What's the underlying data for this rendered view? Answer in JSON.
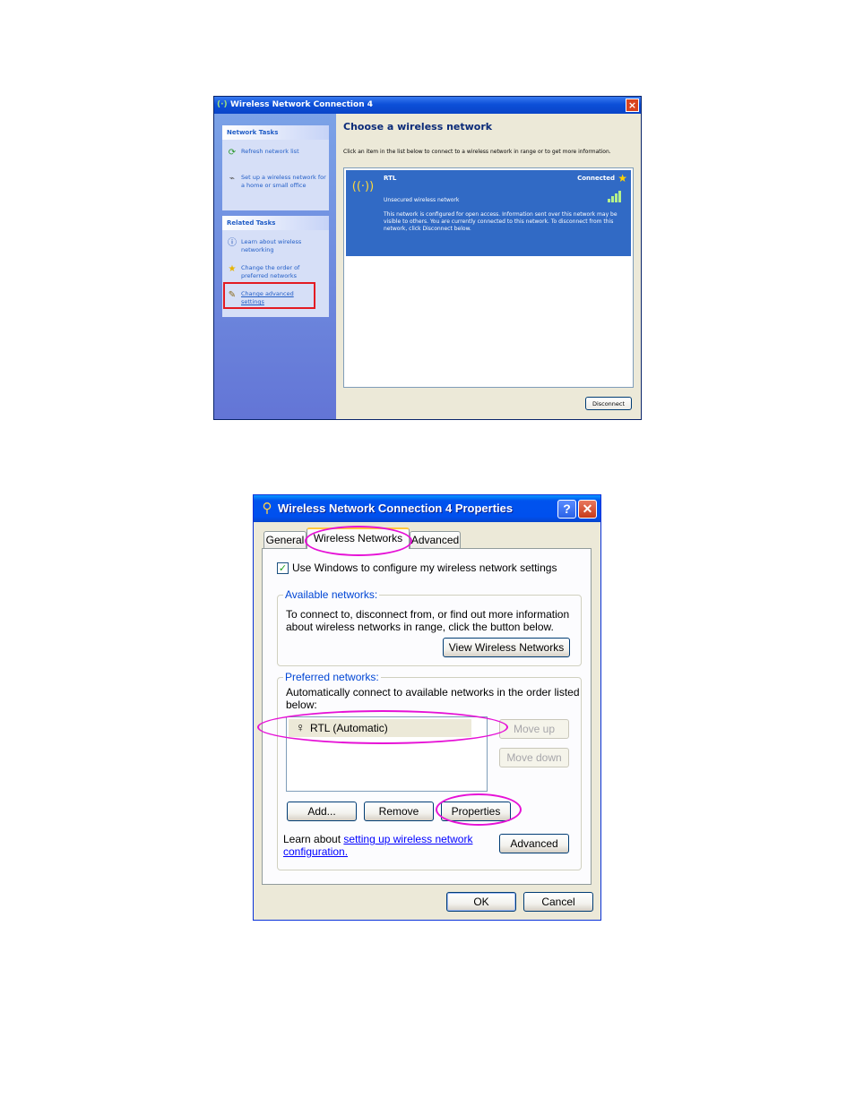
{
  "window1": {
    "title": "Wireless Network Connection 4",
    "network_tasks": {
      "header": "Network Tasks",
      "items": [
        {
          "label": "Refresh network list",
          "icon": "refresh-icon"
        },
        {
          "label": "Set up a wireless network for a home or small office",
          "icon": "wireless-setup-icon"
        }
      ]
    },
    "related_tasks": {
      "header": "Related Tasks",
      "items": [
        {
          "label": "Learn about wireless networking",
          "icon": "info-icon"
        },
        {
          "label": "Change the order of preferred networks",
          "icon": "star-icon"
        },
        {
          "label": "Change advanced settings",
          "icon": "settings-icon"
        }
      ]
    },
    "heading": "Choose a wireless network",
    "instruction": "Click an item in the list below to connect to a wireless network in range or to get more information.",
    "network": {
      "ssid": "RTL",
      "status": "Connected",
      "security": "Unsecured wireless network",
      "description": "This network is configured for open access. Information sent over this network may be visible to others. You are currently connected to this network. To disconnect from this network, click Disconnect below."
    },
    "disconnect_label": "Disconnect",
    "highlight_color": "#e31b23"
  },
  "window2": {
    "title": "Wireless Network Connection 4 Properties",
    "help_label": "?",
    "close_label": "✕",
    "tabs": [
      "General",
      "Wireless Networks",
      "Advanced"
    ],
    "active_tab": "Wireless Networks",
    "use_windows_label": "Use Windows to configure my wireless network settings",
    "use_windows_checked": true,
    "available": {
      "label": "Available networks:",
      "text_line1": "To connect to, disconnect from, or find out more information",
      "text_line2": "about wireless networks in range, click the button below.",
      "view_button": "View Wireless Networks"
    },
    "preferred": {
      "label": "Preferred networks:",
      "text_line1": "Automatically connect to available networks in the order listed",
      "text_line2": "below:",
      "items": [
        "RTL (Automatic)"
      ],
      "move_up": "Move up",
      "move_down": "Move down",
      "add": "Add...",
      "remove": "Remove",
      "properties": "Properties",
      "learn_prefix": "Learn about ",
      "learn_link_line1": "setting up wireless network",
      "learn_link_line2": "configuration.",
      "advanced": "Advanced"
    },
    "ok": "OK",
    "cancel": "Cancel",
    "highlight_color": "#e611d6"
  }
}
